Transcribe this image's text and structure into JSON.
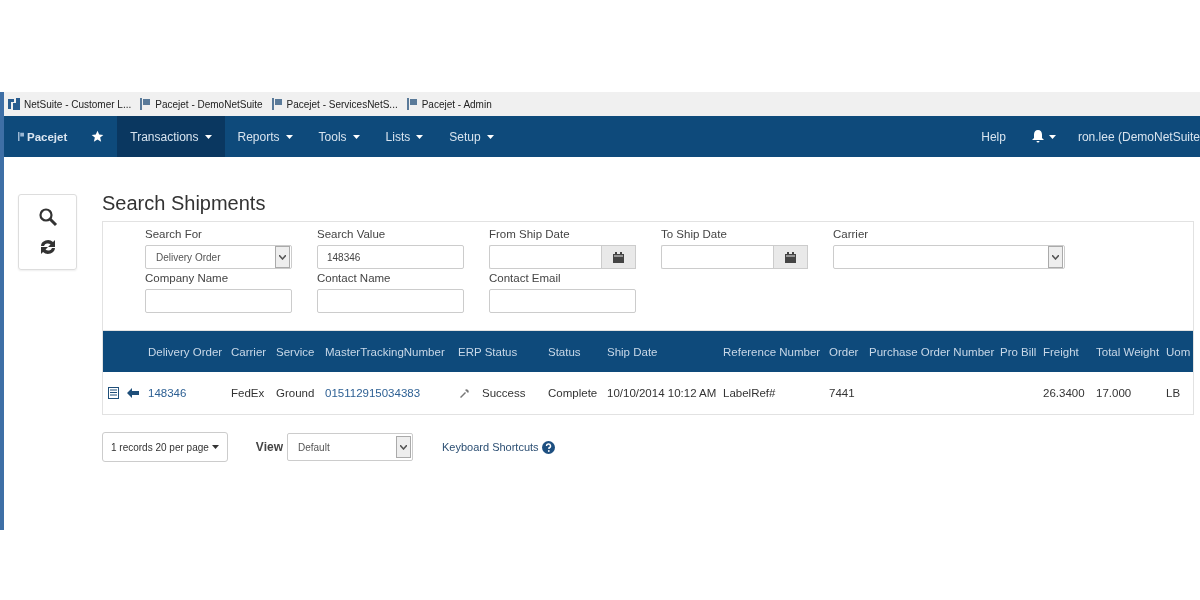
{
  "bookmarks": [
    {
      "label": "NetSuite - Customer L...",
      "kind": "netsuite"
    },
    {
      "label": "Pacejet - DemoNetSuite",
      "kind": "flag"
    },
    {
      "label": "Pacejet - ServicesNetS...",
      "kind": "flag"
    },
    {
      "label": "Pacejet - Admin",
      "kind": "flag"
    }
  ],
  "nav": {
    "brand": "Pacejet",
    "items": [
      {
        "label": "Transactions",
        "selected": true
      },
      {
        "label": "Reports",
        "selected": false
      },
      {
        "label": "Tools",
        "selected": false
      },
      {
        "label": "Lists",
        "selected": false
      },
      {
        "label": "Setup",
        "selected": false
      }
    ],
    "help": "Help",
    "user": "ron.lee (DemoNetSuite"
  },
  "title": "Search Shipments",
  "filters": [
    [
      {
        "label": "Search For",
        "kind": "select",
        "value": "Delivery Order"
      },
      {
        "label": "Search Value",
        "kind": "text",
        "value": "148346"
      },
      {
        "label": "From Ship Date",
        "kind": "date"
      },
      {
        "label": "To Ship Date",
        "kind": "date"
      },
      {
        "label": "Carrier",
        "kind": "wideselect"
      }
    ],
    [
      {
        "label": "Company Name",
        "kind": "text"
      },
      {
        "label": "Contact Name",
        "kind": "text"
      },
      {
        "label": "Contact Email",
        "kind": "text"
      }
    ]
  ],
  "table": {
    "columns": [
      "",
      "Delivery Order",
      "Carrier",
      "Service",
      "MasterTrackingNumber",
      "ERP Status",
      "Status",
      "Ship Date",
      "Reference Number",
      "Order",
      "Purchase Order Number",
      "Pro Bill",
      "Freight",
      "Total Weight",
      "Uom"
    ],
    "rows": [
      {
        "cells": [
          "",
          "148346",
          "FedEx",
          "Ground",
          "015112915034383",
          "Success",
          "Complete",
          "10/10/2014 10:12 AM",
          "LabelRef#",
          "7441",
          "",
          "",
          "26.3400",
          "17.000",
          "LB"
        ]
      }
    ]
  },
  "footer": {
    "pager": "1 records 20 per page",
    "view_label": "View",
    "view_value": "Default",
    "shortcuts": "Keyboard Shortcuts"
  }
}
